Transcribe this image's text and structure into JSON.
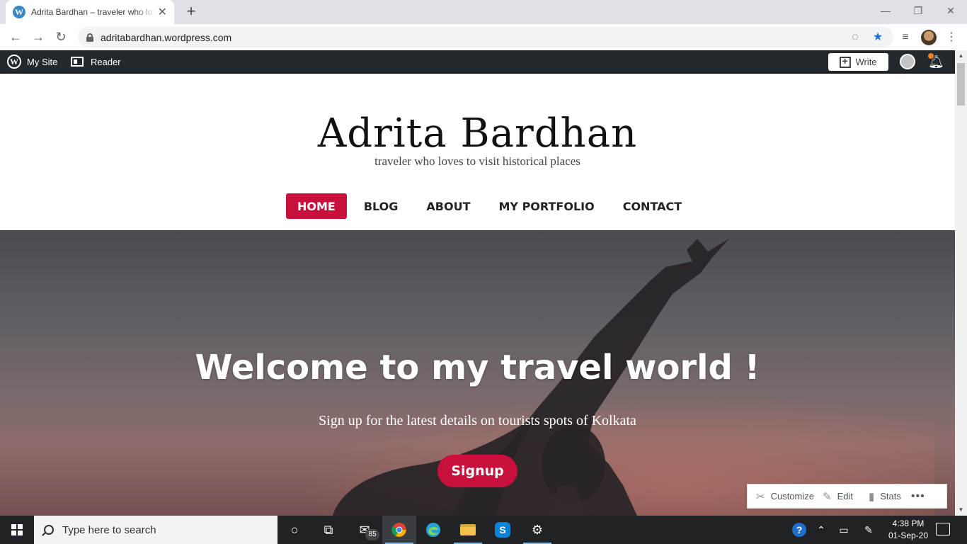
{
  "browser": {
    "tab_title": "Adrita Bardhan – traveler who loves to visit historical places",
    "tab_favicon_letter": "W",
    "url": "adritabardhan.wordpress.com"
  },
  "wp_admin_bar": {
    "my_site": "My Site",
    "reader": "Reader",
    "write": "Write"
  },
  "site": {
    "title": "Adrita Bardhan",
    "tagline": "traveler who loves to visit historical places",
    "menu": [
      {
        "label": "HOME",
        "active": true
      },
      {
        "label": "BLOG",
        "active": false
      },
      {
        "label": "ABOUT",
        "active": false
      },
      {
        "label": "MY PORTFOLIO",
        "active": false
      },
      {
        "label": "CONTACT",
        "active": false
      }
    ]
  },
  "hero": {
    "title": "Welcome to my travel world !",
    "subtitle": "Sign up for the latest details on tourists spots of Kolkata",
    "button": "Signup"
  },
  "edit_toolbar": {
    "customize": "Customize",
    "edit": "Edit",
    "stats": "Stats",
    "more": "•••"
  },
  "taskbar": {
    "search_placeholder": "Type here to search",
    "mail_badge": "85",
    "time": "4:38 PM",
    "date": "01-Sep-20"
  },
  "colors": {
    "accent": "#c8103c",
    "wp_bar": "#23282d"
  }
}
